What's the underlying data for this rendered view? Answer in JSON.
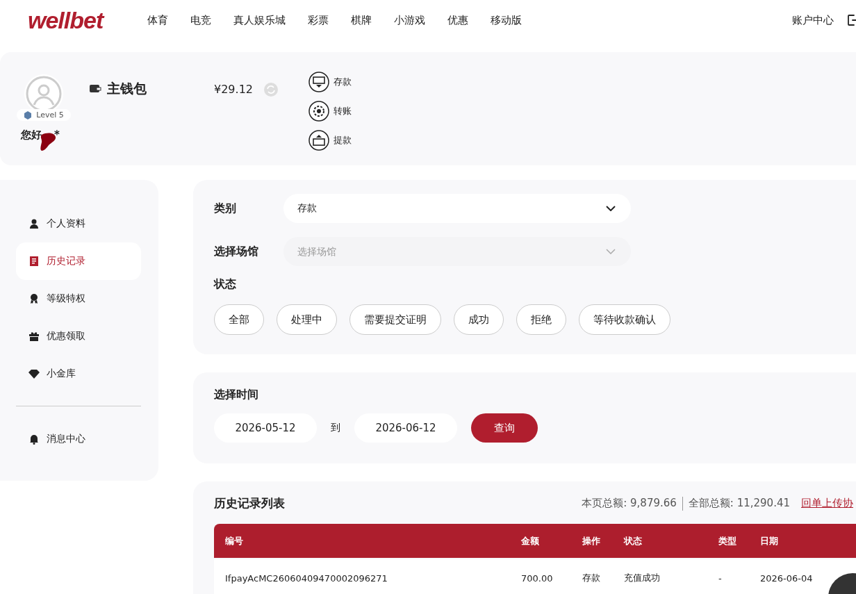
{
  "header": {
    "logo": "wellbet",
    "nav": [
      "体育",
      "电竞",
      "真人娱乐城",
      "彩票",
      "棋牌",
      "小游戏",
      "优惠",
      "移动版"
    ],
    "account": "账户中心"
  },
  "wallet": {
    "level": "Level 5",
    "greeting": "您好",
    "masked": "*",
    "title": "主钱包",
    "balance": "¥29.12",
    "actions": [
      {
        "kind": "deposit",
        "label": "存款"
      },
      {
        "kind": "transfer",
        "label": "转账"
      },
      {
        "kind": "withdraw",
        "label": "提款"
      }
    ]
  },
  "sidebar": {
    "items": [
      {
        "kind": "user",
        "label": "个人资料",
        "selected": false
      },
      {
        "kind": "doc",
        "label": "历史记录",
        "selected": true
      },
      {
        "kind": "medal",
        "label": "等级特权",
        "selected": false
      },
      {
        "kind": "gift",
        "label": "优惠领取",
        "selected": false
      },
      {
        "kind": "diamond",
        "label": "小金库",
        "selected": false
      }
    ],
    "footer_items": [
      {
        "kind": "bell",
        "label": "消息中心",
        "selected": false
      }
    ]
  },
  "filters": {
    "category_label": "类别",
    "category_value": "存款",
    "venue_label": "选择场馆",
    "venue_placeholder": "选择场馆",
    "status_label": "状态",
    "statuses": [
      {
        "label": "全部",
        "selected": false
      },
      {
        "label": "处理中",
        "selected": false
      },
      {
        "label": "需要提交证明",
        "selected": false
      },
      {
        "label": "成功",
        "selected": false
      },
      {
        "label": "拒绝",
        "selected": false
      },
      {
        "label": "等待收款确认",
        "selected": false
      }
    ]
  },
  "time": {
    "label": "选择时间",
    "from": "2026-05-12",
    "separator": "到",
    "to": "2026-06-12",
    "query": "查询"
  },
  "list": {
    "title": "历史记录列表",
    "page_total": "本页总额: 9,879.66",
    "all_total": "全部总额: 11,290.41",
    "link": "回单上传协",
    "columns": [
      "编号",
      "金额",
      "操作",
      "状态",
      "类型",
      "日期"
    ],
    "rows": [
      [
        "IfpayAcMC26060409470002096271",
        "700.00",
        "存款",
        "充值成功",
        "-",
        "2026-06-04"
      ]
    ]
  }
}
